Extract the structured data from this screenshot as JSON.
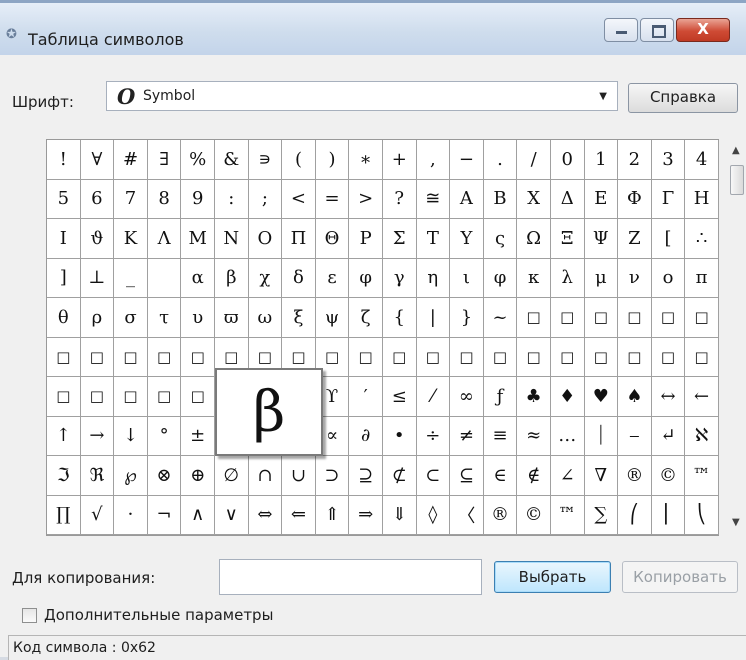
{
  "window": {
    "title": "Таблица символов",
    "close_glyph": "X"
  },
  "font": {
    "label": "Шрифт:",
    "icon_glyph": "O",
    "value": "Symbol"
  },
  "help_label": "Справка",
  "grid": {
    "rows": [
      [
        "!",
        "∀",
        "#",
        "∃",
        "%",
        "&",
        "∍",
        "(",
        ")",
        "∗",
        "+",
        ",",
        "−",
        ".",
        "/",
        "0",
        "1",
        "2",
        "3",
        "4"
      ],
      [
        "5",
        "6",
        "7",
        "8",
        "9",
        ":",
        ";",
        "<",
        "=",
        ">",
        "?",
        "≅",
        "Α",
        "Β",
        "Χ",
        "Δ",
        "Ε",
        "Φ",
        "Γ",
        "Η"
      ],
      [
        "Ι",
        "ϑ",
        "Κ",
        "Λ",
        "Μ",
        "Ν",
        "Ο",
        "Π",
        "Θ",
        "Ρ",
        "Σ",
        "Τ",
        "Υ",
        "ς",
        "Ω",
        "Ξ",
        "Ψ",
        "Ζ",
        "[",
        "∴"
      ],
      [
        "]",
        "⊥",
        "_",
        "",
        "α",
        "β",
        "χ",
        "δ",
        "ε",
        "φ",
        "γ",
        "η",
        "ι",
        "φ",
        "κ",
        "λ",
        "μ",
        "ν",
        "ο",
        "π"
      ],
      [
        "θ",
        "ρ",
        "σ",
        "τ",
        "υ",
        "ϖ",
        "ω",
        "ξ",
        "ψ",
        "ζ",
        "{",
        "|",
        "}",
        "~",
        "□",
        "□",
        "□",
        "□",
        "□",
        "□"
      ],
      [
        "□",
        "□",
        "□",
        "□",
        "□",
        "□",
        "□",
        "□",
        "□",
        "□",
        "□",
        "□",
        "□",
        "□",
        "□",
        "□",
        "□",
        "□",
        "□",
        "□"
      ],
      [
        "□",
        "□",
        "□",
        "□",
        "□",
        "□",
        "□",
        "□",
        "ϒ",
        "′",
        "≤",
        "⁄",
        "∞",
        "ƒ",
        "♣",
        "♦",
        "♥",
        "♠",
        "↔",
        "←"
      ],
      [
        "↑",
        "→",
        "↓",
        "°",
        "±",
        "″",
        "≥",
        "×",
        "∝",
        "∂",
        "•",
        "÷",
        "≠",
        "≡",
        "≈",
        "…",
        "⏐",
        "⎯",
        "↵",
        "ℵ"
      ],
      [
        "ℑ",
        "ℜ",
        "℘",
        "⊗",
        "⊕",
        "∅",
        "∩",
        "∪",
        "⊃",
        "⊇",
        "⊄",
        "⊂",
        "⊆",
        "∈",
        "∉",
        "∠",
        "∇",
        "®",
        "©",
        "™"
      ],
      [
        "∏",
        "√",
        "⋅",
        "¬",
        "∧",
        "∨",
        "⇔",
        "⇐",
        "⇑",
        "⇒",
        "⇓",
        "◊",
        "〈",
        "®",
        "©",
        "™",
        "∑",
        "⎛",
        "⎜",
        "⎝"
      ]
    ],
    "selected": "β"
  },
  "copy": {
    "label": "Для копирования:",
    "value": ""
  },
  "select_label": "Выбрать",
  "copy_button_label": "Копировать",
  "advanced_label": "Дополнительные параметры",
  "status": "Код символа : 0x62"
}
